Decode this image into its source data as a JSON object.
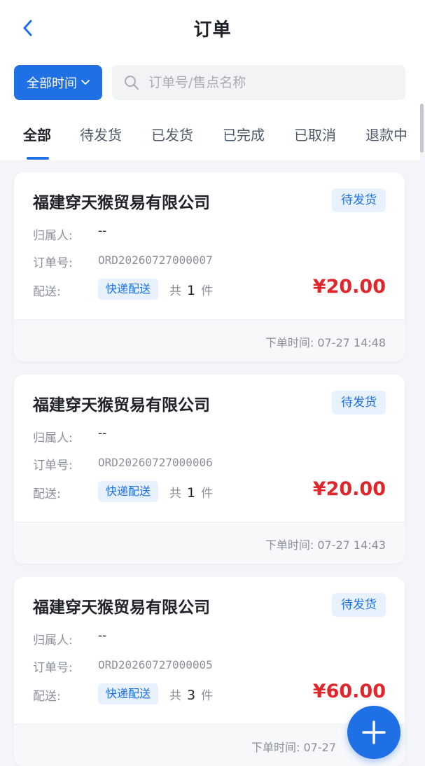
{
  "header": {
    "title": "订单",
    "back_icon": "chevron-left-icon"
  },
  "filter": {
    "time_label": "全部时间",
    "search_placeholder": "订单号/售点名称"
  },
  "tabs": [
    {
      "label": "全部",
      "active": true
    },
    {
      "label": "待发货",
      "active": false
    },
    {
      "label": "已发货",
      "active": false
    },
    {
      "label": "已完成",
      "active": false
    },
    {
      "label": "已取消",
      "active": false
    },
    {
      "label": "退款中",
      "active": false
    }
  ],
  "labels": {
    "owner": "归属人:",
    "order_no": "订单号:",
    "delivery": "配送:",
    "qty_prefix": "共",
    "qty_suffix": "件",
    "time_prefix": "下单时间:"
  },
  "orders": [
    {
      "company": "福建穿天猴贸易有限公司",
      "status": "待发货",
      "owner": "--",
      "order_no": "ORD20260727000007",
      "delivery": "快递配送",
      "qty": "1",
      "price": "¥20.00",
      "time": "07-27 14:48"
    },
    {
      "company": "福建穿天猴贸易有限公司",
      "status": "待发货",
      "owner": "--",
      "order_no": "ORD20260727000006",
      "delivery": "快递配送",
      "qty": "1",
      "price": "¥20.00",
      "time": "07-27 14:43"
    },
    {
      "company": "福建穿天猴贸易有限公司",
      "status": "待发货",
      "owner": "--",
      "order_no": "ORD20260727000005",
      "delivery": "快递配送",
      "qty": "3",
      "price": "¥60.00",
      "time": "07-27"
    }
  ],
  "colors": {
    "accent": "#1f6fe5",
    "price": "#e0262a"
  }
}
